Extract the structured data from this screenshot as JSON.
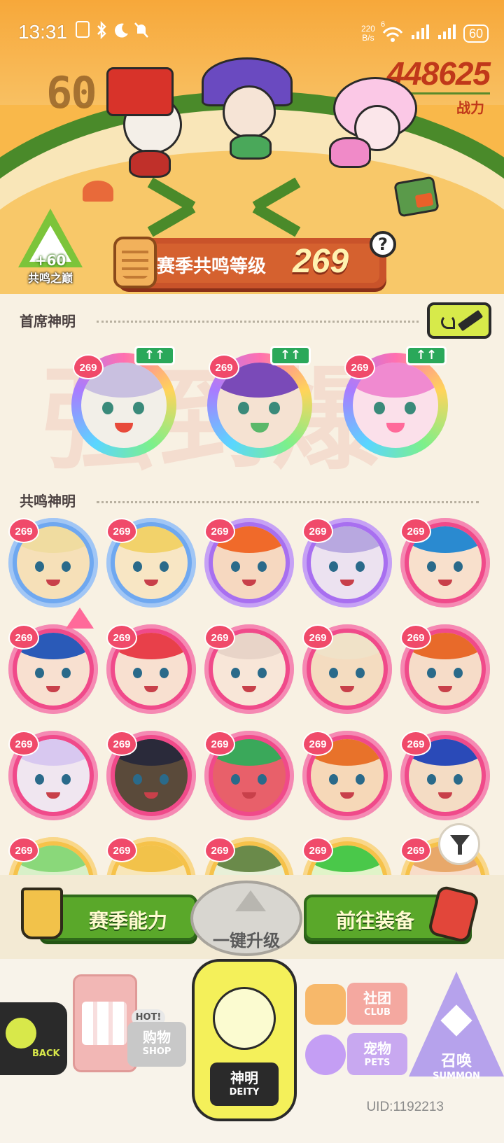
{
  "status_bar": {
    "time": "13:31",
    "net_speed_value": "220",
    "net_speed_unit": "B/s",
    "signal_label": "6",
    "battery": "60"
  },
  "hero": {
    "team_level": "60",
    "power_value": "448625",
    "power_label": "战力"
  },
  "peak": {
    "bonus": "+60",
    "label": "共鸣之巅"
  },
  "resonance": {
    "label": "赛季共鸣等级",
    "value": "269",
    "help": "?"
  },
  "sections": {
    "leaders_title": "首席神明",
    "resonance_title": "共鸣神明"
  },
  "watermark": "强到爆",
  "leaders": [
    {
      "level": "269",
      "up": "↑↑",
      "colors": [
        "#f2efe8",
        "#c9c0e0",
        "#e84a3a"
      ]
    },
    {
      "level": "269",
      "up": "↑↑",
      "colors": [
        "#f5e2d2",
        "#7a4ab8",
        "#5ab86a"
      ]
    },
    {
      "level": "269",
      "up": "↑↑",
      "colors": [
        "#fbe0ea",
        "#f08ad0",
        "#ff6a9a"
      ]
    }
  ],
  "deities": [
    {
      "level": "269",
      "frame": "#6fa8f0",
      "face": "#f6e0b8",
      "hair": "#f0dca0"
    },
    {
      "level": "269",
      "frame": "#6fa8f0",
      "face": "#f8e6c4",
      "hair": "#f2d26a"
    },
    {
      "level": "269",
      "frame": "#a86ff0",
      "face": "#f6d8c0",
      "hair": "#f06a2a"
    },
    {
      "level": "269",
      "frame": "#a86ff0",
      "face": "#ece2f0",
      "hair": "#b8a8e0"
    },
    {
      "level": "269",
      "frame": "#f04a8a",
      "face": "#f8e0cc",
      "hair": "#2a8ad0"
    },
    {
      "level": "269",
      "frame": "#f04a8a",
      "face": "#f8e0d0",
      "hair": "#2a5ab8",
      "crown": true
    },
    {
      "level": "269",
      "frame": "#f04a8a",
      "face": "#f8e0d0",
      "hair": "#e8404a"
    },
    {
      "level": "269",
      "frame": "#f04a8a",
      "face": "#f8e6d8",
      "hair": "#e8d4c8"
    },
    {
      "level": "269",
      "frame": "#f04a8a",
      "face": "#f4dcc0",
      "hair": "#f0e2c8"
    },
    {
      "level": "269",
      "frame": "#f04a8a",
      "face": "#f6dcc8",
      "hair": "#e86a2a"
    },
    {
      "level": "269",
      "frame": "#f04a8a",
      "face": "#f0e6f0",
      "hair": "#d8c8f0"
    },
    {
      "level": "269",
      "frame": "#f04a8a",
      "face": "#5a4a3a",
      "hair": "#2a2a3a"
    },
    {
      "level": "269",
      "frame": "#f04a8a",
      "face": "#e8606a",
      "hair": "#3aa85a"
    },
    {
      "level": "269",
      "frame": "#f04a8a",
      "face": "#f6d8b8",
      "hair": "#e8722a"
    },
    {
      "level": "269",
      "frame": "#f04a8a",
      "face": "#f4dcc4",
      "hair": "#2a4ab8"
    },
    {
      "level": "269",
      "frame": "#f6c24a",
      "face": "#d8f0c8",
      "hair": "#8ad87a"
    },
    {
      "level": "269",
      "frame": "#f6c24a",
      "face": "#f8e6b8",
      "hair": "#f2c24a"
    },
    {
      "level": "269",
      "frame": "#f6c24a",
      "face": "#e8f0d8",
      "hair": "#6a8a4a"
    },
    {
      "level": "269",
      "frame": "#f6c24a",
      "face": "#e0f4c8",
      "hair": "#4ac84a"
    },
    {
      "level": "269",
      "frame": "#f6c24a",
      "face": "#f8dcc8",
      "hair": "#e8a86a"
    }
  ],
  "actions": {
    "season_ability": "赛季能力",
    "one_key_upgrade": "一键升级",
    "go_equip": "前往装备"
  },
  "nav": {
    "back": "BACK",
    "hot": "HOT!",
    "shop_cn": "购物",
    "shop_en": "SHOP",
    "deity_cn": "神明",
    "deity_en": "DEITY",
    "club_cn": "社团",
    "club_en": "CLUB",
    "pets_cn": "宠物",
    "pets_en": "PETS",
    "summon_cn": "召唤",
    "summon_en": "SUMMON"
  },
  "uid": "UID:1192213"
}
